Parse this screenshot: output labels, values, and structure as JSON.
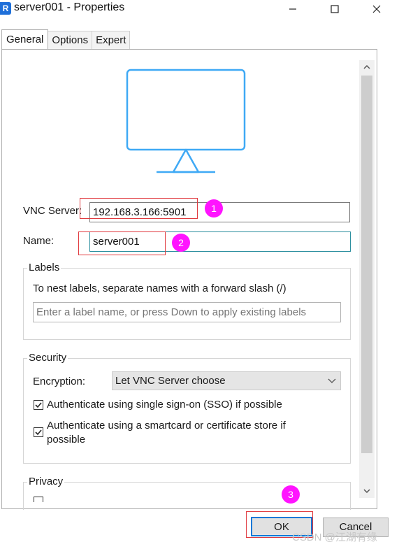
{
  "window": {
    "title": "server001 - Properties",
    "icon_letter": "R",
    "icon": "vnc-viewer-app-icon"
  },
  "tabs": [
    {
      "label": "General",
      "active": true
    },
    {
      "label": "Options",
      "active": false
    },
    {
      "label": "Expert",
      "active": false
    }
  ],
  "form": {
    "vnc_server_label": "VNC Server:",
    "vnc_server_value": "192.168.3.166:5901",
    "name_label": "Name:",
    "name_value": "server001"
  },
  "labels_group": {
    "title": "Labels",
    "hint": "To nest labels, separate names with a forward slash (/)",
    "input_placeholder": "Enter a label name, or press Down to apply existing labels"
  },
  "security_group": {
    "title": "Security",
    "encryption_label": "Encryption:",
    "encryption_value": "Let VNC Server choose",
    "sso_label": "Authenticate using single sign-on (SSO) if possible",
    "sso_checked": true,
    "smartcard_label": "Authenticate using a smartcard or certificate store if possible",
    "smartcard_checked": true
  },
  "privacy_group": {
    "title": "Privacy"
  },
  "buttons": {
    "ok_label": "OK",
    "cancel_label": "Cancel"
  },
  "annotations": {
    "badge_1": "1",
    "badge_2": "2",
    "badge_3": "3",
    "badge_color": "#ff14ff",
    "box_color": "#e0393e"
  },
  "watermark": "CSDN @江湖有缘",
  "colors": {
    "monitor_stroke": "#3fa9f5",
    "ok_border": "#0078d7",
    "name_field_border": "#2a8e9e"
  }
}
